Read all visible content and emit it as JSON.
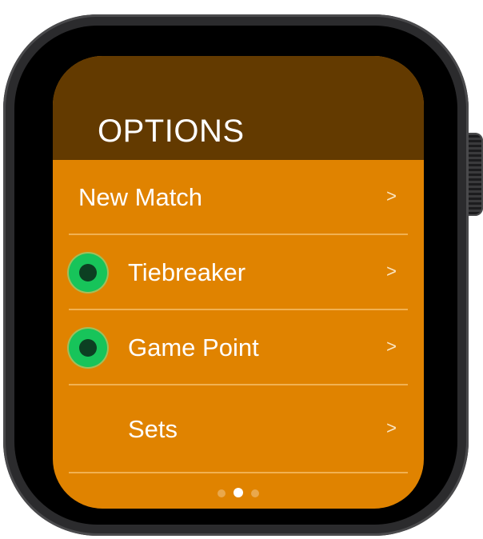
{
  "colors": {
    "header": "#633a00",
    "screen": "#e08300",
    "toggle_on": "#17c45a",
    "toggle_inner": "#0c3f22",
    "watch_case": "#2b2b2d"
  },
  "header": {
    "title": "OPTIONS"
  },
  "menu": {
    "items": [
      {
        "label": "New Match",
        "chevron": ">",
        "toggle": false
      },
      {
        "label": "Tiebreaker",
        "chevron": ">",
        "toggle": true,
        "icon": "toggle-dot-icon"
      },
      {
        "label": "Game Point",
        "chevron": ">",
        "toggle": true,
        "icon": "toggle-dot-icon"
      },
      {
        "label": "Sets",
        "chevron": ">",
        "toggle": false
      }
    ]
  },
  "pager": {
    "page_count": 3,
    "current_page": 2
  }
}
